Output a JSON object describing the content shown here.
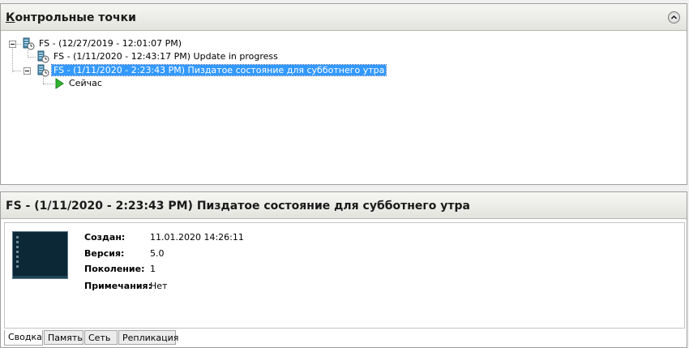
{
  "checkpoints_panel": {
    "title_accel": "К",
    "title_rest": "онтрольные точки",
    "collapse_icon": "chevron-up-circle-icon",
    "tree": [
      {
        "label": "FS - (12/27/2019 - 12:01:07 PM)",
        "icon": "checkpoint-icon",
        "level": 0,
        "expanded": true
      },
      {
        "label": "FS - (1/11/2020 - 12:43:17 PM) Update in progress",
        "icon": "checkpoint-icon",
        "level": 1
      },
      {
        "label": "FS - (1/11/2020 - 2:23:43 PM) Пиздатое состояние для субботнего утра",
        "icon": "checkpoint-icon",
        "level": 1,
        "expanded": true,
        "selected": true
      },
      {
        "label": "Сейчас",
        "icon": "now-play-icon",
        "level": 2
      }
    ]
  },
  "details_panel": {
    "title": "FS - (1/11/2020 - 2:23:43 PM) Пиздатое состояние для субботнего утра",
    "thumbnail_icon": "vm-screenshot-thumbnail",
    "properties": [
      {
        "key": "Создан:",
        "value": "11.01.2020 14:26:11"
      },
      {
        "key": "Версия:",
        "value": "5.0"
      },
      {
        "key": "Поколение:",
        "value": "1"
      },
      {
        "key": "Примечания:",
        "value": "Нет"
      }
    ],
    "tabs": [
      "Сводка",
      "Память",
      "Сеть",
      "Репликация"
    ],
    "active_tab": "Сводка"
  },
  "colors": {
    "selection": "#3399ff",
    "header_bg": "#e8e8e4",
    "now_icon": "#2fb52f"
  }
}
